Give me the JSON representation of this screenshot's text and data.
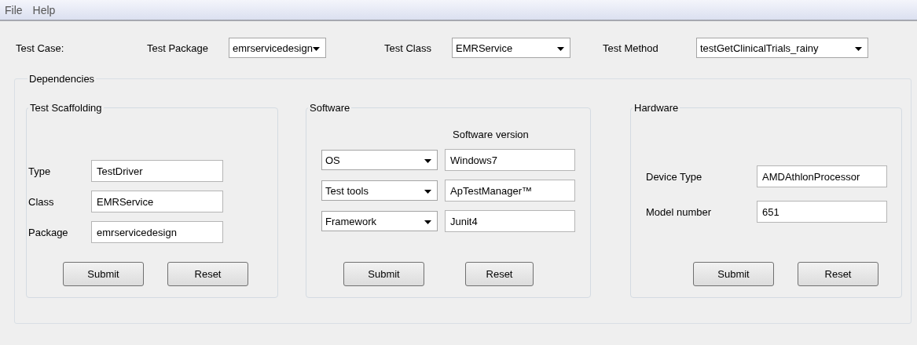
{
  "menu": [
    {
      "label": "File"
    },
    {
      "label": "Help"
    }
  ],
  "test_case": {
    "label": "Test Case:",
    "fields": [
      {
        "label": "Test Package",
        "value": "emrservicedesign"
      },
      {
        "label": "Test Class",
        "value": "EMRService"
      },
      {
        "label": "Test Method",
        "value": "testGetClinicalTrials_rainy"
      }
    ]
  },
  "dependencies": {
    "title": "Dependencies",
    "scaffolding": {
      "title": "Test Scaffolding",
      "rows": [
        {
          "label": "Type",
          "value": "TestDriver"
        },
        {
          "label": "Class",
          "value": "EMRService"
        },
        {
          "label": "Package",
          "value": "emrservicedesign"
        }
      ],
      "buttons": [
        "Submit",
        "Reset"
      ]
    },
    "software": {
      "title": "Software",
      "column_header": "Software version",
      "rows": [
        {
          "category": "OS",
          "version": "Windows7"
        },
        {
          "category": "Test tools",
          "version": "ApTestManager™"
        },
        {
          "category": "Framework",
          "version": "Junit4"
        }
      ],
      "buttons": [
        "Submit",
        "Reset"
      ]
    },
    "hardware": {
      "title": "Hardware",
      "rows": [
        {
          "label": "Device Type",
          "value": "AMDAthlonProcessor"
        },
        {
          "label": "Model number",
          "value": "651"
        }
      ],
      "buttons": [
        "Submit",
        "Reset"
      ]
    }
  }
}
